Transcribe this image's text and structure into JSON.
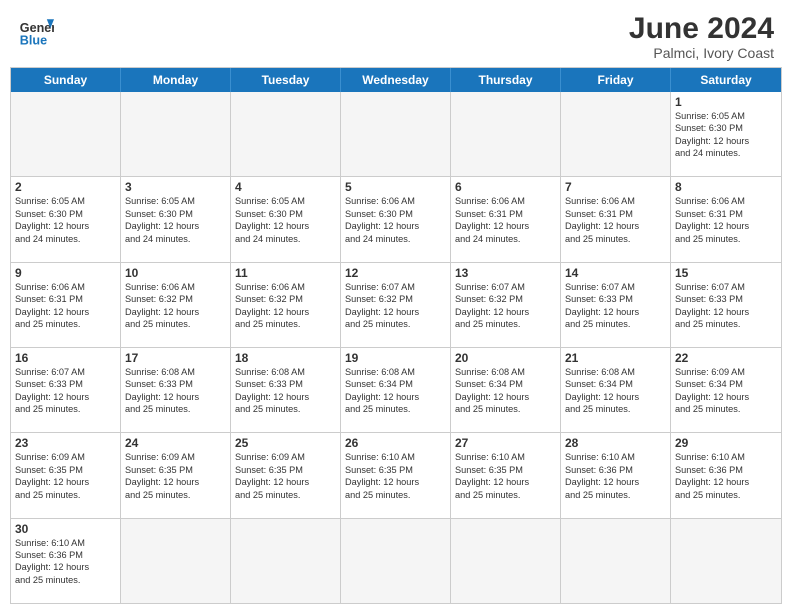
{
  "header": {
    "logo_general": "General",
    "logo_blue": "Blue",
    "title": "June 2024",
    "subtitle": "Palmci, Ivory Coast"
  },
  "days_of_week": [
    "Sunday",
    "Monday",
    "Tuesday",
    "Wednesday",
    "Thursday",
    "Friday",
    "Saturday"
  ],
  "weeks": [
    [
      {
        "day": "",
        "info": "",
        "empty": true
      },
      {
        "day": "",
        "info": "",
        "empty": true
      },
      {
        "day": "",
        "info": "",
        "empty": true
      },
      {
        "day": "",
        "info": "",
        "empty": true
      },
      {
        "day": "",
        "info": "",
        "empty": true
      },
      {
        "day": "",
        "info": "",
        "empty": true
      },
      {
        "day": "1",
        "info": "Sunrise: 6:05 AM\nSunset: 6:30 PM\nDaylight: 12 hours\nand 24 minutes."
      }
    ],
    [
      {
        "day": "2",
        "info": "Sunrise: 6:05 AM\nSunset: 6:30 PM\nDaylight: 12 hours\nand 24 minutes."
      },
      {
        "day": "3",
        "info": "Sunrise: 6:05 AM\nSunset: 6:30 PM\nDaylight: 12 hours\nand 24 minutes."
      },
      {
        "day": "4",
        "info": "Sunrise: 6:05 AM\nSunset: 6:30 PM\nDaylight: 12 hours\nand 24 minutes."
      },
      {
        "day": "5",
        "info": "Sunrise: 6:06 AM\nSunset: 6:30 PM\nDaylight: 12 hours\nand 24 minutes."
      },
      {
        "day": "6",
        "info": "Sunrise: 6:06 AM\nSunset: 6:31 PM\nDaylight: 12 hours\nand 24 minutes."
      },
      {
        "day": "7",
        "info": "Sunrise: 6:06 AM\nSunset: 6:31 PM\nDaylight: 12 hours\nand 25 minutes."
      },
      {
        "day": "8",
        "info": "Sunrise: 6:06 AM\nSunset: 6:31 PM\nDaylight: 12 hours\nand 25 minutes."
      }
    ],
    [
      {
        "day": "9",
        "info": "Sunrise: 6:06 AM\nSunset: 6:31 PM\nDaylight: 12 hours\nand 25 minutes."
      },
      {
        "day": "10",
        "info": "Sunrise: 6:06 AM\nSunset: 6:32 PM\nDaylight: 12 hours\nand 25 minutes."
      },
      {
        "day": "11",
        "info": "Sunrise: 6:06 AM\nSunset: 6:32 PM\nDaylight: 12 hours\nand 25 minutes."
      },
      {
        "day": "12",
        "info": "Sunrise: 6:07 AM\nSunset: 6:32 PM\nDaylight: 12 hours\nand 25 minutes."
      },
      {
        "day": "13",
        "info": "Sunrise: 6:07 AM\nSunset: 6:32 PM\nDaylight: 12 hours\nand 25 minutes."
      },
      {
        "day": "14",
        "info": "Sunrise: 6:07 AM\nSunset: 6:33 PM\nDaylight: 12 hours\nand 25 minutes."
      },
      {
        "day": "15",
        "info": "Sunrise: 6:07 AM\nSunset: 6:33 PM\nDaylight: 12 hours\nand 25 minutes."
      }
    ],
    [
      {
        "day": "16",
        "info": "Sunrise: 6:07 AM\nSunset: 6:33 PM\nDaylight: 12 hours\nand 25 minutes."
      },
      {
        "day": "17",
        "info": "Sunrise: 6:08 AM\nSunset: 6:33 PM\nDaylight: 12 hours\nand 25 minutes."
      },
      {
        "day": "18",
        "info": "Sunrise: 6:08 AM\nSunset: 6:33 PM\nDaylight: 12 hours\nand 25 minutes."
      },
      {
        "day": "19",
        "info": "Sunrise: 6:08 AM\nSunset: 6:34 PM\nDaylight: 12 hours\nand 25 minutes."
      },
      {
        "day": "20",
        "info": "Sunrise: 6:08 AM\nSunset: 6:34 PM\nDaylight: 12 hours\nand 25 minutes."
      },
      {
        "day": "21",
        "info": "Sunrise: 6:08 AM\nSunset: 6:34 PM\nDaylight: 12 hours\nand 25 minutes."
      },
      {
        "day": "22",
        "info": "Sunrise: 6:09 AM\nSunset: 6:34 PM\nDaylight: 12 hours\nand 25 minutes."
      }
    ],
    [
      {
        "day": "23",
        "info": "Sunrise: 6:09 AM\nSunset: 6:35 PM\nDaylight: 12 hours\nand 25 minutes."
      },
      {
        "day": "24",
        "info": "Sunrise: 6:09 AM\nSunset: 6:35 PM\nDaylight: 12 hours\nand 25 minutes."
      },
      {
        "day": "25",
        "info": "Sunrise: 6:09 AM\nSunset: 6:35 PM\nDaylight: 12 hours\nand 25 minutes."
      },
      {
        "day": "26",
        "info": "Sunrise: 6:10 AM\nSunset: 6:35 PM\nDaylight: 12 hours\nand 25 minutes."
      },
      {
        "day": "27",
        "info": "Sunrise: 6:10 AM\nSunset: 6:35 PM\nDaylight: 12 hours\nand 25 minutes."
      },
      {
        "day": "28",
        "info": "Sunrise: 6:10 AM\nSunset: 6:36 PM\nDaylight: 12 hours\nand 25 minutes."
      },
      {
        "day": "29",
        "info": "Sunrise: 6:10 AM\nSunset: 6:36 PM\nDaylight: 12 hours\nand 25 minutes."
      }
    ],
    [
      {
        "day": "30",
        "info": "Sunrise: 6:10 AM\nSunset: 6:36 PM\nDaylight: 12 hours\nand 25 minutes."
      },
      {
        "day": "",
        "info": "",
        "empty": true
      },
      {
        "day": "",
        "info": "",
        "empty": true
      },
      {
        "day": "",
        "info": "",
        "empty": true
      },
      {
        "day": "",
        "info": "",
        "empty": true
      },
      {
        "day": "",
        "info": "",
        "empty": true
      },
      {
        "day": "",
        "info": "",
        "empty": true
      }
    ]
  ]
}
